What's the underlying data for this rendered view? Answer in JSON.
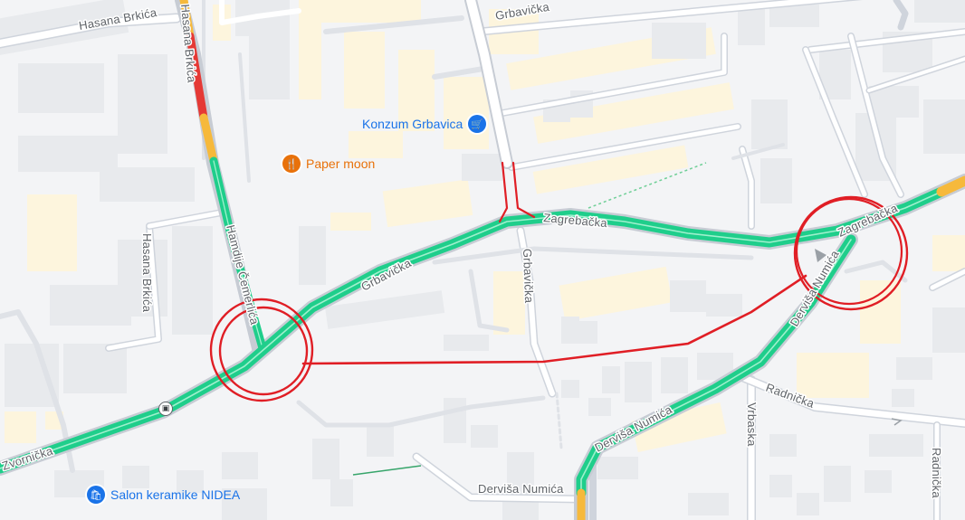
{
  "map": {
    "colors": {
      "background": "#f3f4f6",
      "building": "#fdf5dd",
      "block": "#e8eaed",
      "road": "#ffffff",
      "road_casing": "#cfd4dc",
      "traffic_green": "#1fce8b",
      "traffic_orange": "#f6b93b",
      "traffic_red": "#e53935",
      "annotation_red": "#e01e25",
      "poi_blue": "#1a73e8",
      "poi_orange": "#e8710a"
    },
    "streets": {
      "hasana_brkica": "Hasana Brkića",
      "hasana_brkica_vertical": "Hasana Brkića",
      "grbavicka_top": "Grbavička",
      "zagrebacka_mid": "Zagrebačka",
      "zagrebacka_right": "Zagrebačka",
      "hamdije_cemerlica": "Hamdije Čemerlića",
      "grbavicka_main": "Grbavička",
      "grbavicka_vertical": "Grbavička",
      "dervisa_numica_right": "Derviša Numića",
      "dervisa_numica_low": "Derviša Numića",
      "dervisa_numica_bottom": "Derviša Numića",
      "radnicka_mid": "Radnička",
      "radnicka_right": "Radnička",
      "vrbaska": "Vrbaska",
      "zvornicka": "Zvornička"
    },
    "pois": [
      {
        "label": "Konzum Grbavica",
        "icon": "shopping-cart-icon",
        "color": "#1a73e8"
      },
      {
        "label": "Paper moon",
        "icon": "restaurant-icon",
        "color": "#e8710a"
      },
      {
        "label": "Salon keramike NIDEA",
        "icon": "shopping-bag-icon",
        "color": "#1a73e8"
      }
    ],
    "annotations": {
      "circles": 2,
      "connector_line": true,
      "color": "#e01e25"
    },
    "traffic": {
      "legend": [
        "green",
        "orange",
        "red"
      ]
    }
  }
}
